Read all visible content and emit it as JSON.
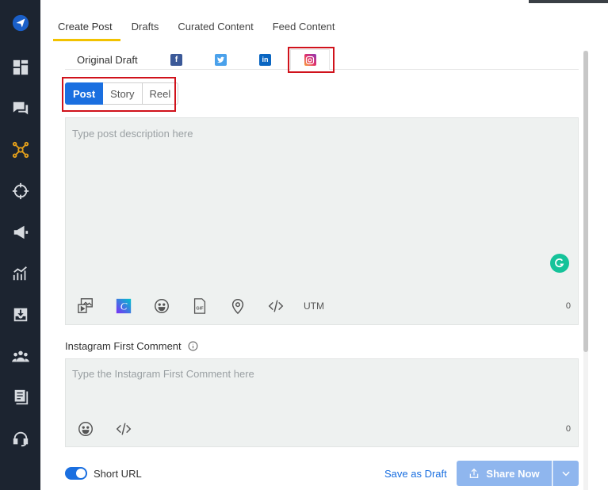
{
  "tabs": [
    {
      "label": "Create Post",
      "active": true
    },
    {
      "label": "Drafts",
      "active": false
    },
    {
      "label": "Curated Content",
      "active": false
    },
    {
      "label": "Feed Content",
      "active": false
    }
  ],
  "networks": {
    "original_draft": "Original Draft",
    "facebook_letter": "f",
    "linkedin_letter": "in"
  },
  "post_types": {
    "post": "Post",
    "story": "Story",
    "reel": "Reel",
    "selected": "Post"
  },
  "description": {
    "placeholder": "Type post description here",
    "char_count": "0",
    "utm_label": "UTM"
  },
  "first_comment": {
    "label": "Instagram First Comment",
    "placeholder": "Type the Instagram First Comment here",
    "char_count": "0"
  },
  "footer": {
    "short_url_label": "Short URL",
    "short_url_enabled": true,
    "save_draft": "Save as Draft",
    "share_now": "Share Now"
  },
  "colors": {
    "accent": "#1a6fe0",
    "tab_underline": "#f2c200",
    "sidebar_bg": "#1c2430",
    "highlight_border": "#d0121b",
    "grammarly": "#15c39a"
  },
  "icons": {
    "sidebar": [
      "paper-plane-logo-icon",
      "dashboard-icon",
      "chat-icon",
      "network-icon",
      "target-icon",
      "megaphone-icon",
      "analytics-icon",
      "inbox-download-icon",
      "team-icon",
      "document-icon",
      "headset-icon"
    ],
    "toolbar": [
      "media-icon",
      "canva-icon",
      "emoji-icon",
      "gif-icon",
      "location-icon",
      "code-icon"
    ]
  }
}
